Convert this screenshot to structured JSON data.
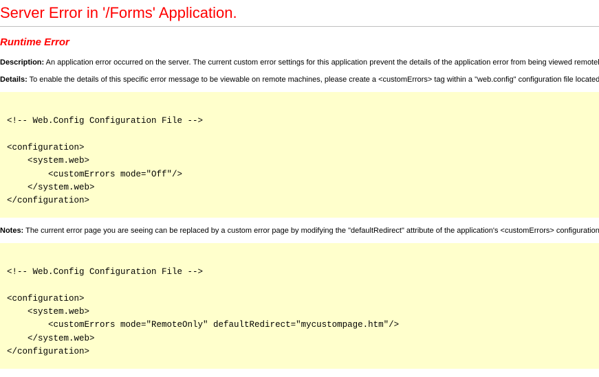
{
  "header": {
    "title": "Server Error in '/Forms' Application."
  },
  "sub_header": {
    "title": "Runtime Error"
  },
  "description": {
    "label": "Description:",
    "text": "An application error occurred on the server. The current custom error settings for this application prevent the details of the application error from being viewed remotely."
  },
  "details": {
    "label": "Details:",
    "text": "To enable the details of this specific error message to be viewable on remote machines, please create a <customErrors> tag within a \"web.config\" configuration file located in the root directory of the current web application."
  },
  "code_block_1": "\n<!-- Web.Config Configuration File -->\n\n<configuration>\n    <system.web>\n        <customErrors mode=\"Off\"/>\n    </system.web>\n</configuration>",
  "notes": {
    "label": "Notes:",
    "text": "The current error page you are seeing can be replaced by a custom error page by modifying the \"defaultRedirect\" attribute of the application's <customErrors> configuration tag to point to a custom error page URL."
  },
  "code_block_2": "\n<!-- Web.Config Configuration File -->\n\n<configuration>\n    <system.web>\n        <customErrors mode=\"RemoteOnly\" defaultRedirect=\"mycustompage.htm\"/>\n    </system.web>\n</configuration>"
}
